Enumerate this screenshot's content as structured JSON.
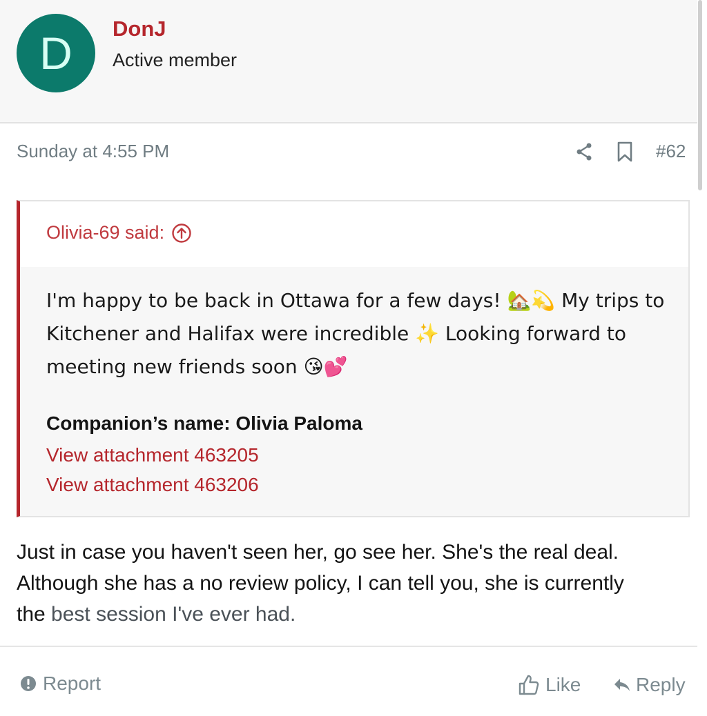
{
  "user": {
    "avatar_letter": "D",
    "name": "DonJ",
    "title": "Active member"
  },
  "post": {
    "date": "Sunday at 4:55 PM",
    "number": "#62"
  },
  "quote": {
    "author": "Olivia-69 said:",
    "line1": "I'm happy to be back in Ottawa for a few days! 🏡💫 My trips to",
    "line2": "Kitchener and Halifax were incredible ✨ Looking forward to",
    "line3": "meeting new friends soon 😘💕",
    "companion": "Companion’s name: Olivia Paloma",
    "attachment_1": "View attachment 463205",
    "attachment_2": "View attachment 463206"
  },
  "message": {
    "line1": "Just in case you haven't seen her, go see her. She's the real deal.",
    "line2": "Although she has a no review policy, I can tell you, she is currently",
    "line3_start": "the ",
    "line3_faded": "best session I've ever had."
  },
  "actions": {
    "report": "Report",
    "like": "Like",
    "reply": "Reply"
  },
  "colors": {
    "accent": "#b5262c",
    "avatar_bg": "#0c7a6b",
    "muted": "#707d83"
  },
  "icons": [
    "share-icon",
    "bookmark-icon",
    "arrow-up-circle-icon",
    "alert-icon",
    "thumbs-up-icon",
    "reply-icon"
  ]
}
